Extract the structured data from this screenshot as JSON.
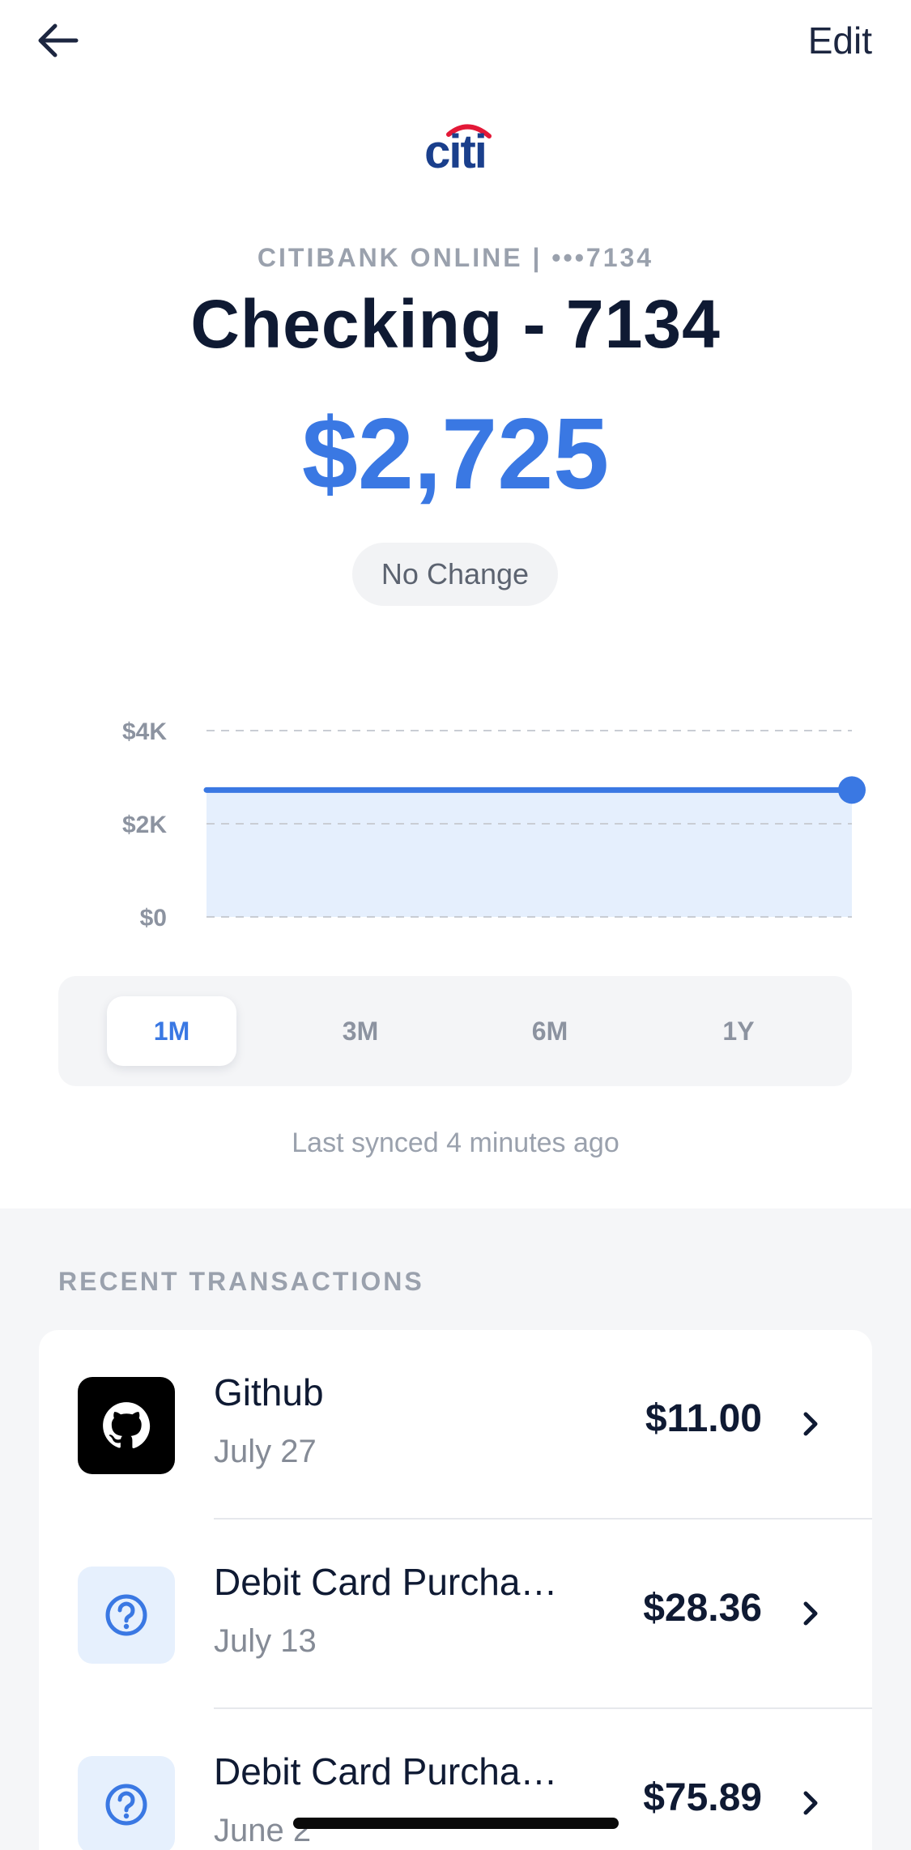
{
  "header": {
    "edit_label": "Edit"
  },
  "logo": {
    "text": "citi",
    "arc_color": "#e31837",
    "text_color": "#1a3f8c"
  },
  "account": {
    "institution": "CITIBANK ONLINE | •••7134",
    "name": "Checking - 7134",
    "balance": "$2,725",
    "change": "No Change"
  },
  "colors": {
    "accent": "#3a78e3",
    "area_fill": "#e5effd"
  },
  "chart_data": {
    "type": "area",
    "x": [
      0,
      1
    ],
    "values": [
      2725,
      2725
    ],
    "ylim": [
      0,
      4000
    ],
    "yticks": [
      {
        "value": 4000,
        "label": "$4K"
      },
      {
        "value": 2000,
        "label": "$2K"
      },
      {
        "value": 0,
        "label": "$0"
      }
    ],
    "grid": true,
    "grid_style": "dashed"
  },
  "range": {
    "options": [
      "1M",
      "3M",
      "6M",
      "1Y"
    ],
    "selected": "1M"
  },
  "sync_text": "Last synced 4 minutes ago",
  "transactions": {
    "heading": "RECENT TRANSACTIONS",
    "items": [
      {
        "name": "Github",
        "date": "July 27",
        "amount": "$11.00",
        "icon": "github-icon"
      },
      {
        "name": "Debit Card Purcha…",
        "date": "July 13",
        "amount": "$28.36",
        "icon": "question-icon"
      },
      {
        "name": "Debit Card Purcha…",
        "date": "June 2",
        "amount": "$75.89",
        "icon": "question-icon"
      }
    ]
  }
}
